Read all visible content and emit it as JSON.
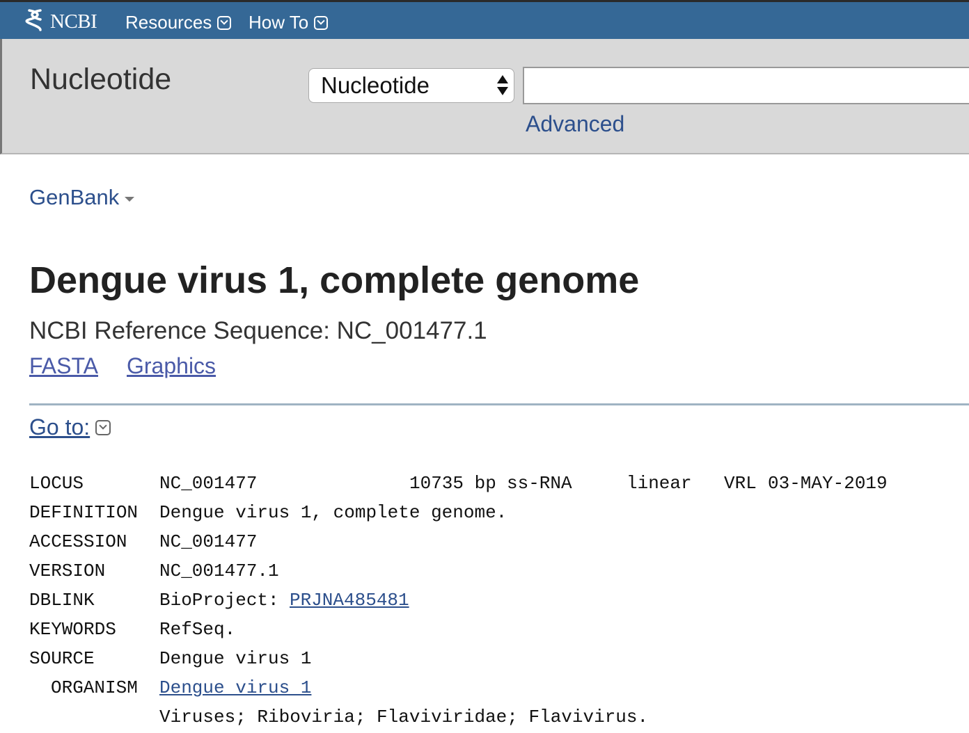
{
  "topbar": {
    "logo_text": "NCBI",
    "nav": [
      {
        "label": "Resources"
      },
      {
        "label": "How To"
      }
    ]
  },
  "search": {
    "db_title": "Nucleotide",
    "db_select_value": "Nucleotide",
    "query_value": "",
    "advanced_label": "Advanced"
  },
  "record": {
    "format_label": "GenBank",
    "title": "Dengue virus 1, complete genome",
    "refseq_line": "NCBI Reference Sequence: NC_001477.1",
    "links": {
      "fasta": "FASTA",
      "graphics": "Graphics"
    },
    "goto_label": "Go to:"
  },
  "genbank": {
    "locus_key": "LOCUS",
    "locus_name": "NC_001477",
    "locus_length": "10735 bp",
    "locus_moltype": "ss-RNA",
    "locus_topology": "linear",
    "locus_div": "VRL",
    "locus_date": "03-MAY-2019",
    "definition_key": "DEFINITION",
    "definition_value": "Dengue virus 1, complete genome.",
    "accession_key": "ACCESSION",
    "accession_value": "NC_001477",
    "version_key": "VERSION",
    "version_value": "NC_001477.1",
    "dblink_key": "DBLINK",
    "dblink_prefix": "BioProject:",
    "dblink_link": "PRJNA485481",
    "keywords_key": "KEYWORDS",
    "keywords_value": "RefSeq.",
    "source_key": "SOURCE",
    "source_value": "Dengue virus 1",
    "organism_key": "ORGANISM",
    "organism_link": "Dengue virus 1",
    "lineage": "Viruses; Riboviria; Flaviviridae; Flavivirus."
  },
  "icons": {
    "logo": "ncbi-helix-icon",
    "nav_dropdown": "chevron-down-icon",
    "select_arrows": "updown-arrows-icon",
    "format_caret": "caret-down-icon"
  }
}
